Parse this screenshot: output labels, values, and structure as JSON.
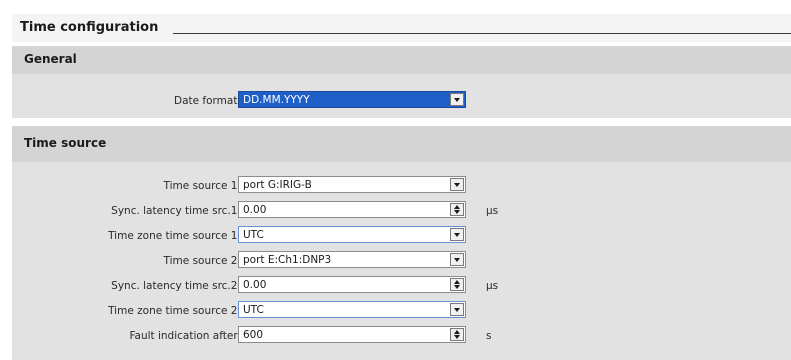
{
  "page": {
    "title": "Time configuration"
  },
  "general": {
    "title": "General",
    "date_format": {
      "label": "Date format:",
      "value": "DD.MM.YYYY"
    }
  },
  "time_source": {
    "title": "Time source",
    "rows": [
      {
        "label": "Time source 1:",
        "value": "port G:IRIG-B",
        "control": "dropdown"
      },
      {
        "label": "Sync. latency time src.1:",
        "value": "0.00",
        "control": "spinner",
        "unit": "µs"
      },
      {
        "label": "Time zone time source 1:",
        "value": "UTC",
        "control": "dropdown"
      },
      {
        "label": "Time source 2:",
        "value": "port E:Ch1:DNP3",
        "control": "dropdown"
      },
      {
        "label": "Sync. latency time src.2:",
        "value": "0.00",
        "control": "spinner",
        "unit": "µs"
      },
      {
        "label": "Time zone time source 2:",
        "value": "UTC",
        "control": "dropdown"
      },
      {
        "label": "Fault indication after:",
        "value": "600",
        "control": "spinner",
        "unit": "s"
      }
    ]
  },
  "colors": {
    "selection": "#1f5fc8",
    "section_header": "#d4d4d4",
    "section_body": "#e2e2e2"
  }
}
